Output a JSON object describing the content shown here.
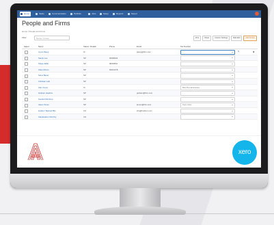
{
  "nav": {
    "items": [
      {
        "label": "Home",
        "active": true
      },
      {
        "label": "Tasks"
      },
      {
        "label": "Communication"
      },
      {
        "label": "Portfolio"
      },
      {
        "label": "Jobs"
      },
      {
        "label": "Setup"
      },
      {
        "label": "Reports"
      },
      {
        "label": "Saved"
      }
    ]
  },
  "page": {
    "title": "People and Firms",
    "breadcrumb": "Home / People and Firms"
  },
  "filter": {
    "label": "Filter",
    "placeholder": "Name / Group"
  },
  "toolbar": {
    "buttons": [
      "Print",
      "Share",
      "Column Settings",
      "Bulk Edit"
    ],
    "primary": "Add Person"
  },
  "table": {
    "columns": [
      "Select",
      "Name",
      "Status / Details",
      "Phone",
      "Email",
      "Tax Number"
    ],
    "rows": [
      {
        "name": "Joyce Wang",
        "type": "IC",
        "phone": "",
        "email": "jwang@firm.com",
        "dd": "",
        "active": true
      },
      {
        "name": "Sandy Lee",
        "type": "SP",
        "phone": "93338241",
        "email": "",
        "dd": ""
      },
      {
        "name": "Shaun Miller",
        "type": "SP",
        "phone": "98328811",
        "email": "",
        "dd": ""
      },
      {
        "name": "Clare Moran",
        "type": "SP",
        "phone": "93221478",
        "email": "",
        "dd": ""
      },
      {
        "name": "Steve Bauer",
        "type": "SP",
        "phone": "",
        "email": "",
        "dd": ""
      },
      {
        "name": "Christian Leib",
        "type": "SP",
        "phone": "",
        "email": "",
        "dd": ""
      },
      {
        "name": "Alan Jones",
        "type": "IC",
        "phone": "",
        "email": "",
        "dd": "Blue Pine Enterprises"
      },
      {
        "name": "Graham Hopkins",
        "type": "SP",
        "phone": "",
        "email": "graham@firm.com",
        "dd": ""
      },
      {
        "name": "Scarlett Winthrop",
        "type": "SP",
        "phone": "",
        "email": "",
        "dd": ""
      },
      {
        "name": "Jason Tonen",
        "type": "SP",
        "phone": "",
        "email": "jtonen@firm.com",
        "dd": "Team Clare"
      },
      {
        "name": "Hudson Tailored Bits",
        "type": "CO",
        "phone": "",
        "email": "info@hudson.com",
        "dd": ""
      },
      {
        "name": "Clandestine Orbit Pty",
        "type": "CO",
        "phone": "",
        "email": "",
        "dd": ""
      }
    ]
  },
  "banner": {
    "xero_text": "xero"
  },
  "colors": {
    "nav": "#2f5f9c",
    "link": "#2f6db5",
    "xero": "#13b5ea",
    "accent": "#d62b2b"
  }
}
